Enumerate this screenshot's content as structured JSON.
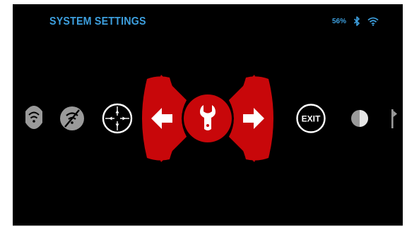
{
  "header": {
    "title": "SYSTEM SETTINGS",
    "battery": "56%",
    "bluetooth_icon": "bluetooth-icon",
    "wifi_icon": "wifi-icon"
  },
  "carousel": {
    "items": [
      {
        "icon": "wifi-icon",
        "state": "dim"
      },
      {
        "icon": "wifi-off-icon",
        "state": "dim"
      },
      {
        "icon": "crosshair-icon",
        "state": "visible"
      },
      {
        "icon": "arrow-left-icon",
        "state": "nav"
      },
      {
        "icon": "wrench-icon",
        "state": "selected"
      },
      {
        "icon": "arrow-right-icon",
        "state": "nav"
      },
      {
        "icon": "exit-icon",
        "label": "EXIT",
        "state": "visible"
      },
      {
        "icon": "contrast-icon",
        "state": "dim"
      },
      {
        "icon": "flag-icon",
        "state": "dim"
      }
    ]
  },
  "colors": {
    "background": "#000000",
    "accent_red": "#c8070a",
    "title_blue": "#3d9fde",
    "icon_white": "#ffffff",
    "icon_dim": "#9a9a9a"
  }
}
